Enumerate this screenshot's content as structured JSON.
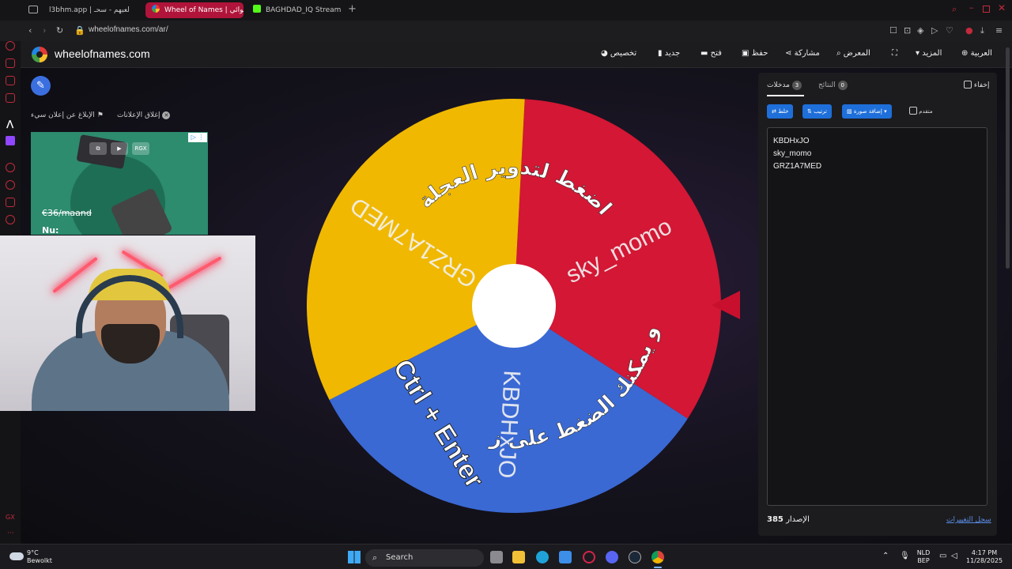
{
  "browser": {
    "tabs": [
      {
        "label": "l3bhm.app | لعبهم - سحـ"
      },
      {
        "label": "Wheel of Names | عشوائي"
      },
      {
        "label": "BAGHDAD_IQ Stream - W"
      }
    ],
    "url": "wheelofnames.com/ar/"
  },
  "site": {
    "name": "wheelofnames.com",
    "menu": {
      "customize": "تخصيص",
      "new": "جديد",
      "open": "فتح",
      "save": "حفظ",
      "share": "مشاركة",
      "gallery": "المعرض",
      "more": "المزيد",
      "language": "العربية"
    }
  },
  "ad": {
    "report": "الإبلاغ عن إعلان سيء",
    "close": "إغلاق الإعلانات",
    "price": "€36/maand",
    "nu": "Nu:",
    "rgx": "RGX"
  },
  "wheel": {
    "instruction_top": "اضغط لتدوير العجلة",
    "instruction_bottom": "أو يمكنك الضغط على زر",
    "shortcut": "Ctrl + Enter",
    "segments": [
      {
        "label": "sky_momo",
        "color": "#d31734"
      },
      {
        "label": "KBDHxJO",
        "color": "#3a69d4"
      },
      {
        "label": "GRZ1A7MED",
        "color": "#f0b800"
      }
    ],
    "pointer_color": "#c8102e"
  },
  "panel": {
    "hide_label": "إخفاء",
    "tabs": {
      "entries": "مدخلات",
      "entries_count": "3",
      "results": "النتائج",
      "results_count": "0"
    },
    "buttons": {
      "shuffle": "خلط",
      "sort": "ترتيب",
      "add_image": "إضافة صورة",
      "advanced": "متقدم"
    },
    "entries": [
      "KBDHxJO",
      "sky_momo",
      "GRZ1A7MED"
    ],
    "version_label": "الإصدار",
    "version": "385",
    "changelog": "سجل التغييرات"
  },
  "taskbar": {
    "weather_temp": "9°C",
    "weather_desc": "Bewolkt",
    "search": "Search",
    "lang_1": "NLD",
    "lang_2": "BEP",
    "time": "4:17 PM",
    "date": "11/28/2025"
  }
}
